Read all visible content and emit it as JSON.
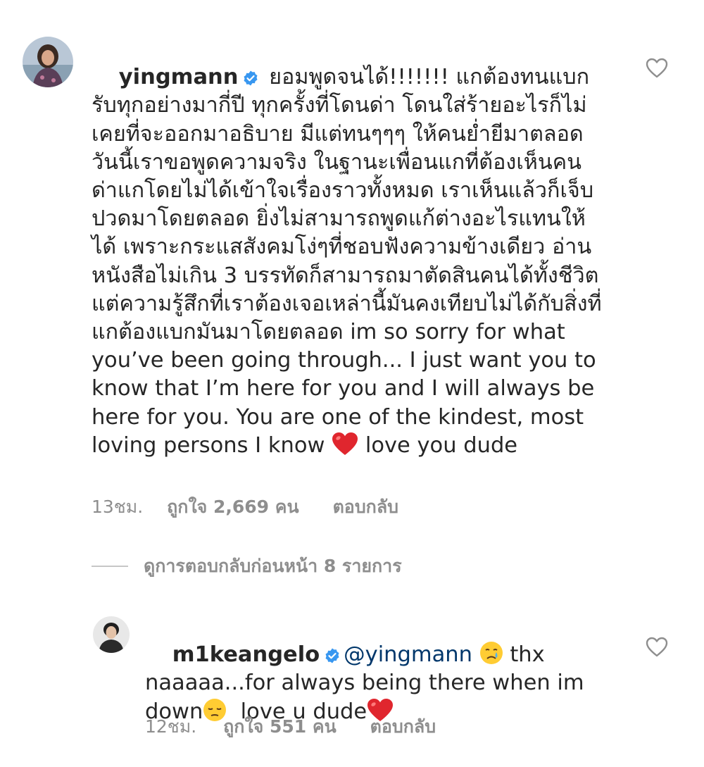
{
  "comment": {
    "username": "yingmann",
    "text_thai": " ยอมพูดจนได้!!!!!!! แกต้องทนแบกรับทุกอย่างมากี่ปี ทุกครั้งที่โดนด่า โดนใส่ร้ายอะไรก็ไม่เคยที่จะออกมาอธิบาย มีแต่ทนๆๆๆ ให้คนย่ำยีมาตลอด วันนี้เราขอพูดความจริง ในฐานะเพื่อนแกที่ต้องเห็นคนด่าแกโดยไม่ได้เข้าใจเรื่องราวทั้งหมด เราเห็นแล้วก็เจ็บปวดมาโดยตลอด ยิ่งไม่สามารถพูดแก้ต่างอะไรแทนให้ได้ เพราะกระแสสังคมโง่ๆที่ชอบฟังความข้างเดียว อ่านหนังสือไม่เกิน 3 บรรทัดก็สามารถมาตัดสินคนได้ทั้งชีวิต  แต่ความรู้สึกที่เราต้องเจอเหล่านี้มันคงเทียบไม่ได้กับสิ่งที่แกต้องแบกมันมาโดยตลอด im so sorry for what you’ve been going through... I just want you to know that I’m here for you and I will always be here for you. You are one of the kindest, most loving persons I know ",
    "text_end": " love you dude",
    "emoji_icon": "red-heart-emoji",
    "time": "13ชม.",
    "likes": "ถูกใจ 2,669 คน",
    "reply": "ตอบกลับ"
  },
  "view_replies": "ดูการตอบกลับก่อนหน้า 8 รายการ",
  "reply_comment": {
    "username": "m1keangelo",
    "mention": "@yingmann",
    "text_a": " thx naaaaa...for always being there when im down",
    "text_b": "  love u dude",
    "emoji_icons": [
      "crying-face-emoji",
      "pensive-face-emoji",
      "red-heart-emoji"
    ],
    "time": "12ชม.",
    "likes": "ถูกใจ 551 คน",
    "reply": "ตอบกลับ"
  },
  "colors": {
    "text": "#262626",
    "meta": "#8e8e8e",
    "mention": "#00376b",
    "verified": "#3897f0",
    "heart": "#e0262e"
  }
}
